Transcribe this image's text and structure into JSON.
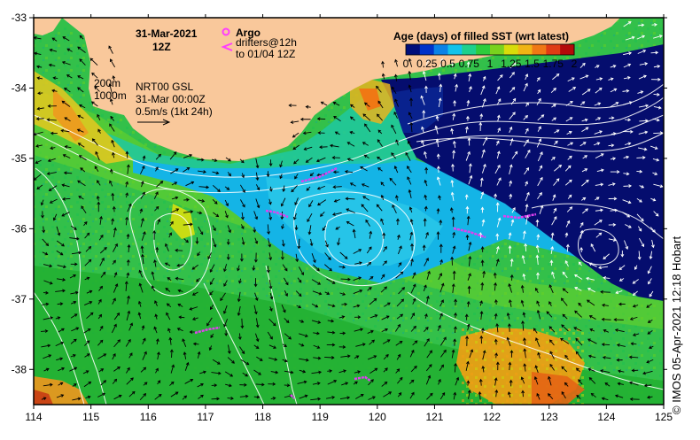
{
  "map": {
    "date_title": "31-Mar-2021",
    "time_title": "12Z",
    "argo_label": "Argo",
    "drifters_label_1": "drifters@12h",
    "drifters_label_2": "to 01/04 12Z",
    "iso_200": "200m",
    "iso_1000": "1000m",
    "product_1": "NRT00 GSL",
    "product_2": "31-Mar 00:00Z",
    "vector_scale": "0.5m/s (1kt 24h)",
    "credit": "© IMOS 05-Apr-2021 12:18 Hobart",
    "lon_ticks": [
      "114",
      "115",
      "116",
      "117",
      "118",
      "119",
      "120",
      "121",
      "122",
      "123",
      "124",
      "125"
    ],
    "lat_ticks": [
      "-33",
      "-34",
      "-35",
      "-36",
      "-37",
      "-38"
    ],
    "extent": {
      "lon": [
        114,
        125
      ],
      "lat": [
        -38.5,
        -33
      ]
    }
  },
  "colorbar": {
    "title": "Age (days) of filled SST (wrt latest)",
    "ticks": [
      "0",
      "0.25",
      "0.5",
      "0.75",
      "1",
      "1.25",
      "1.5",
      "1.75",
      "2"
    ],
    "range": [
      0,
      2
    ],
    "colors": [
      "#000e7a",
      "#0032c8",
      "#0a82e6",
      "#12c3ea",
      "#1ed08c",
      "#2ecc3c",
      "#7ad21e",
      "#d8dc0a",
      "#f0b414",
      "#f07814",
      "#e03c14",
      "#b40a0a"
    ]
  },
  "colors": {
    "land": "#f9c89b",
    "deep_blue": "#050d6e",
    "argo": "#ff3cff",
    "drifter": "#e040f0"
  }
}
